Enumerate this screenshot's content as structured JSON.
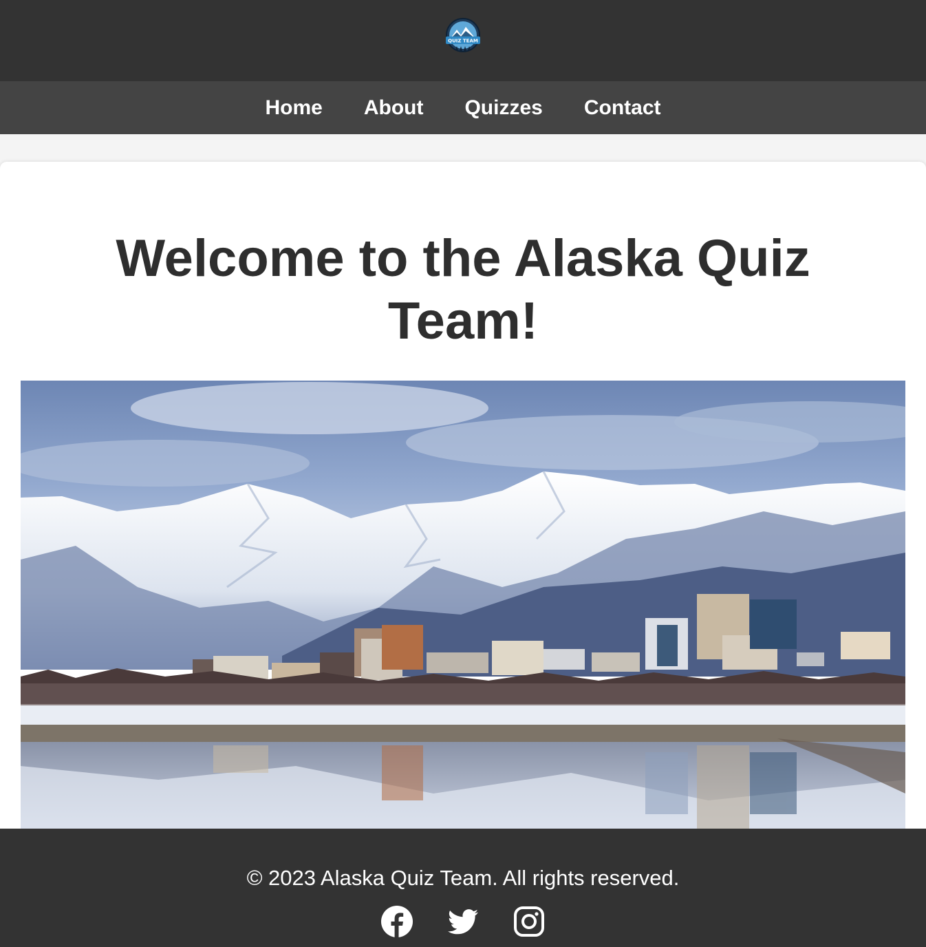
{
  "header": {
    "logo_text": "QUIZ TEAM",
    "logo_icon": "mountain-badge-logo"
  },
  "nav": {
    "items": [
      {
        "label": "Home"
      },
      {
        "label": "About"
      },
      {
        "label": "Quizzes"
      },
      {
        "label": "Contact"
      }
    ]
  },
  "main": {
    "title": "Welcome to the Alaska Quiz Team!",
    "hero_image": "anchorage-skyline-snowy-mountains-photo"
  },
  "footer": {
    "copyright": "© 2023 Alaska Quiz Team. All rights reserved.",
    "social_icons": [
      "facebook-icon",
      "twitter-icon",
      "instagram-icon"
    ]
  },
  "colors": {
    "header_bg": "#333333",
    "nav_bg": "#444444",
    "page_bg": "#f4f4f4",
    "card_bg": "#ffffff",
    "title_color": "#2e2e2e",
    "footer_bg": "#333333"
  }
}
